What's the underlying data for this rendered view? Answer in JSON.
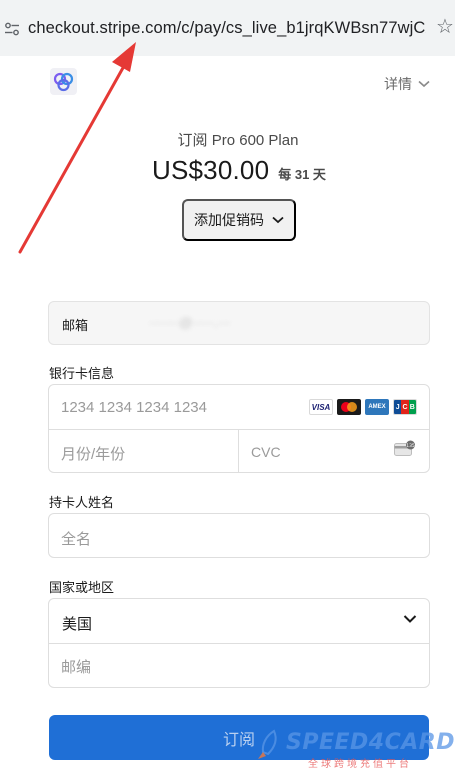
{
  "browser": {
    "url": "checkout.stripe.com/c/pay/cs_live_b1jrqKWBsn77wjCXcH...",
    "tune_icon": "site-info-icon",
    "star_icon": "bookmark-star-icon"
  },
  "header": {
    "logo_icon": "brand-logo-icon",
    "details_label": "详情"
  },
  "product": {
    "plan_name": "订阅 Pro 600 Plan",
    "price": "US$30.00",
    "period": "每 31 天",
    "promo_label": "添加促销码"
  },
  "form": {
    "email_label": "邮箱",
    "email_value": "·······@·····.···",
    "card_section_label": "银行卡信息",
    "card_number_placeholder": "1234 1234 1234 1234",
    "expiry_placeholder": "月份/年份",
    "cvc_placeholder": "CVC",
    "card_brands": [
      "VISA",
      "mastercard",
      "AMEX",
      "JCB"
    ],
    "cardholder_label": "持卡人姓名",
    "cardholder_placeholder": "全名",
    "country_label": "国家或地区",
    "country_value": "美国",
    "zip_placeholder": "邮编",
    "submit_label": "订阅"
  },
  "watermark": {
    "name": "SPEED4CARD",
    "tagline": "全球跨境充值平台"
  },
  "colors": {
    "accent": "#1f6fd6",
    "arrow": "#e53935",
    "border": "#dedede"
  }
}
